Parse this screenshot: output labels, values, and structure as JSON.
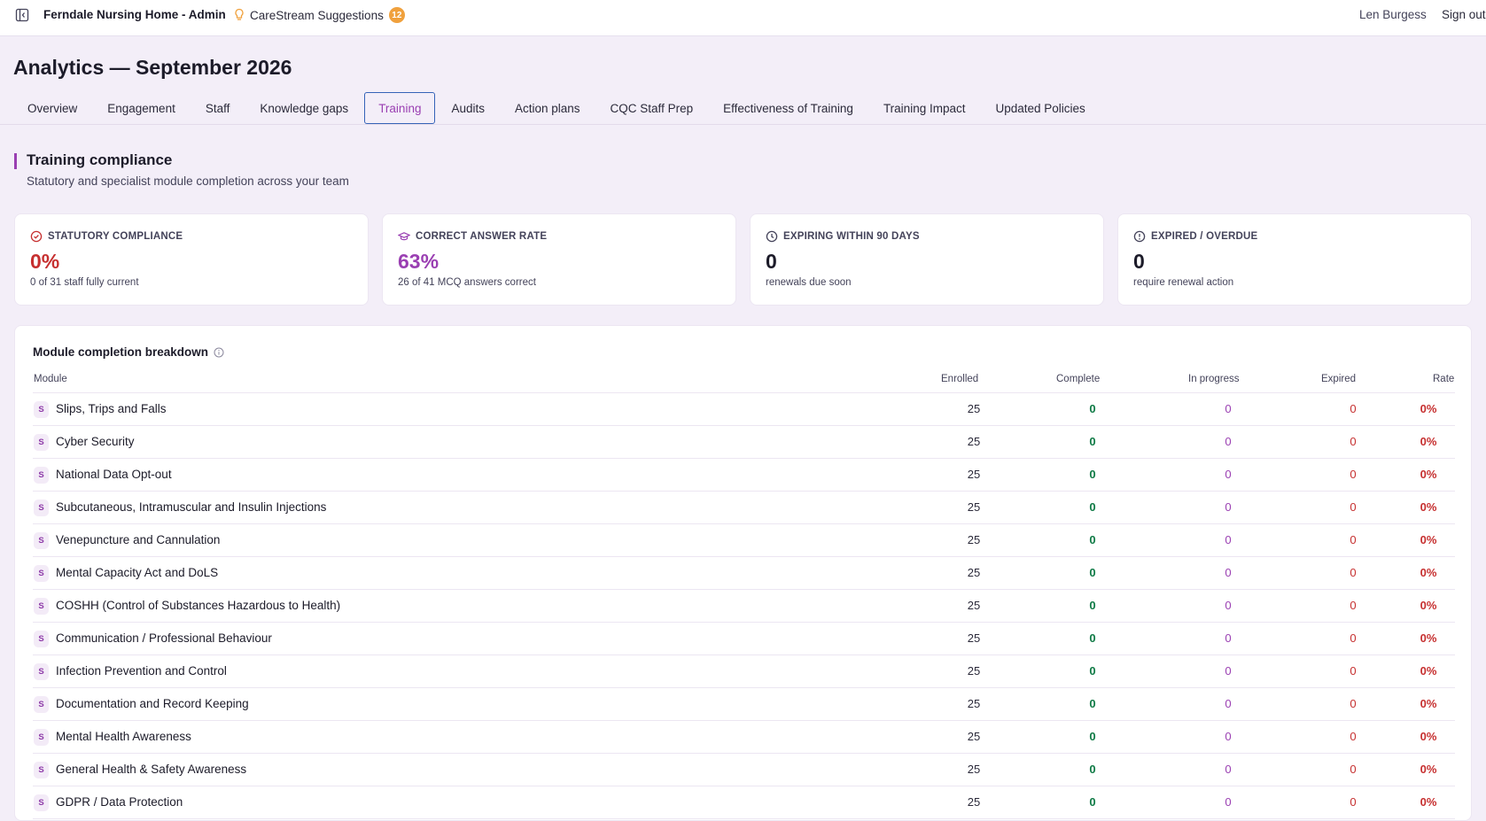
{
  "header": {
    "app_title": "Ferndale Nursing Home - Admin",
    "suggestions_label": "CareStream Suggestions",
    "suggestions_count": "12",
    "user_name": "Len Burgess",
    "sign_out": "Sign out"
  },
  "page": {
    "title": "Analytics — September 2026"
  },
  "tabs": [
    {
      "label": "Overview"
    },
    {
      "label": "Engagement"
    },
    {
      "label": "Staff"
    },
    {
      "label": "Knowledge gaps"
    },
    {
      "label": "Training",
      "active": true
    },
    {
      "label": "Audits"
    },
    {
      "label": "Action plans"
    },
    {
      "label": "CQC Staff Prep"
    },
    {
      "label": "Effectiveness of Training"
    },
    {
      "label": "Training Impact"
    },
    {
      "label": "Updated Policies"
    }
  ],
  "section": {
    "title": "Training compliance",
    "subtitle": "Statutory and specialist module completion across your team"
  },
  "cards": [
    {
      "icon": "check-circle-icon",
      "title": "STATUTORY COMPLIANCE",
      "value": "0%",
      "sub": "0 of 31 staff fully current",
      "color": "#c62f2f"
    },
    {
      "icon": "graduation-cap-icon",
      "title": "CORRECT ANSWER RATE",
      "value": "63%",
      "sub": "26 of 41 MCQ answers correct",
      "color": "#9a3fb2"
    },
    {
      "icon": "clock-icon",
      "title": "EXPIRING WITHIN 90 DAYS",
      "value": "0",
      "sub": "renewals due soon",
      "color": "#1c1b29"
    },
    {
      "icon": "alert-circle-icon",
      "title": "EXPIRED / OVERDUE",
      "value": "0",
      "sub": "require renewal action",
      "color": "#1c1b29"
    }
  ],
  "table": {
    "title": "Module completion breakdown",
    "columns": {
      "module": "Module",
      "enrolled": "Enrolled",
      "complete": "Complete",
      "in_progress": "In progress",
      "expired": "Expired",
      "rate": "Rate"
    },
    "rows": [
      {
        "chip": "S",
        "module": "Slips, Trips and Falls",
        "enrolled": "25",
        "complete": "0",
        "in_progress": "0",
        "expired": "0",
        "rate": "0%"
      },
      {
        "chip": "S",
        "module": "Cyber Security",
        "enrolled": "25",
        "complete": "0",
        "in_progress": "0",
        "expired": "0",
        "rate": "0%"
      },
      {
        "chip": "S",
        "module": "National Data Opt-out",
        "enrolled": "25",
        "complete": "0",
        "in_progress": "0",
        "expired": "0",
        "rate": "0%"
      },
      {
        "chip": "S",
        "module": "Subcutaneous, Intramuscular and Insulin Injections",
        "enrolled": "25",
        "complete": "0",
        "in_progress": "0",
        "expired": "0",
        "rate": "0%"
      },
      {
        "chip": "S",
        "module": "Venepuncture and Cannulation",
        "enrolled": "25",
        "complete": "0",
        "in_progress": "0",
        "expired": "0",
        "rate": "0%"
      },
      {
        "chip": "S",
        "module": "Mental Capacity Act and DoLS",
        "enrolled": "25",
        "complete": "0",
        "in_progress": "0",
        "expired": "0",
        "rate": "0%"
      },
      {
        "chip": "S",
        "module": "COSHH (Control of Substances Hazardous to Health)",
        "enrolled": "25",
        "complete": "0",
        "in_progress": "0",
        "expired": "0",
        "rate": "0%"
      },
      {
        "chip": "S",
        "module": "Communication / Professional Behaviour",
        "enrolled": "25",
        "complete": "0",
        "in_progress": "0",
        "expired": "0",
        "rate": "0%"
      },
      {
        "chip": "S",
        "module": "Infection Prevention and Control",
        "enrolled": "25",
        "complete": "0",
        "in_progress": "0",
        "expired": "0",
        "rate": "0%"
      },
      {
        "chip": "S",
        "module": "Documentation and Record Keeping",
        "enrolled": "25",
        "complete": "0",
        "in_progress": "0",
        "expired": "0",
        "rate": "0%"
      },
      {
        "chip": "S",
        "module": "Mental Health Awareness",
        "enrolled": "25",
        "complete": "0",
        "in_progress": "0",
        "expired": "0",
        "rate": "0%"
      },
      {
        "chip": "S",
        "module": "General Health & Safety Awareness",
        "enrolled": "25",
        "complete": "0",
        "in_progress": "0",
        "expired": "0",
        "rate": "0%"
      },
      {
        "chip": "S",
        "module": "GDPR / Data Protection",
        "enrolled": "25",
        "complete": "0",
        "in_progress": "0",
        "expired": "0",
        "rate": "0%"
      }
    ]
  }
}
